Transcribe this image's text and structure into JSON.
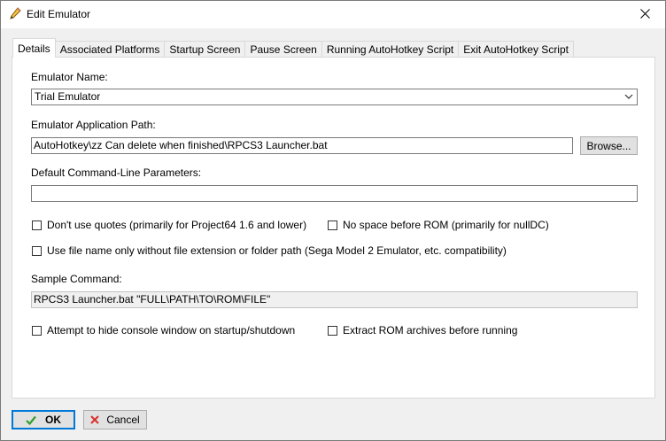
{
  "window": {
    "title": "Edit Emulator",
    "title_icon": "pencil-icon",
    "close_icon": "close-icon"
  },
  "tabs": [
    {
      "label": "Details",
      "active": true
    },
    {
      "label": "Associated Platforms",
      "active": false
    },
    {
      "label": "Startup Screen",
      "active": false
    },
    {
      "label": "Pause Screen",
      "active": false
    },
    {
      "label": "Running AutoHotkey Script",
      "active": false
    },
    {
      "label": "Exit AutoHotkey Script",
      "active": false
    }
  ],
  "details": {
    "emulator_name_label": "Emulator Name:",
    "emulator_name_value": "Trial Emulator",
    "app_path_label": "Emulator Application Path:",
    "app_path_value": "AutoHotkey\\zz Can delete when finished\\RPCS3 Launcher.bat",
    "browse_label": "Browse...",
    "params_label": "Default Command-Line Parameters:",
    "params_value": "",
    "checkboxes": {
      "no_quotes": {
        "label": "Don't use quotes (primarily for Project64 1.6 and lower)",
        "checked": false
      },
      "no_space": {
        "label": "No space before ROM (primarily for nullDC)",
        "checked": false
      },
      "file_name_only": {
        "label": "Use file name only without file extension or folder path (Sega Model 2 Emulator, etc. compatibility)",
        "checked": false
      },
      "hide_console": {
        "label": "Attempt to hide console window on startup/shutdown",
        "checked": false
      },
      "extract_rom": {
        "label": "Extract ROM archives before running",
        "checked": false
      }
    },
    "sample_label": "Sample Command:",
    "sample_value": "RPCS3 Launcher.bat \"FULL\\PATH\\TO\\ROM\\FILE\""
  },
  "footer": {
    "ok_label": "OK",
    "ok_icon": "checkmark-icon",
    "ok_color": "#2e9e2e",
    "cancel_label": "Cancel",
    "cancel_icon": "x-icon",
    "cancel_color": "#d9302c"
  }
}
